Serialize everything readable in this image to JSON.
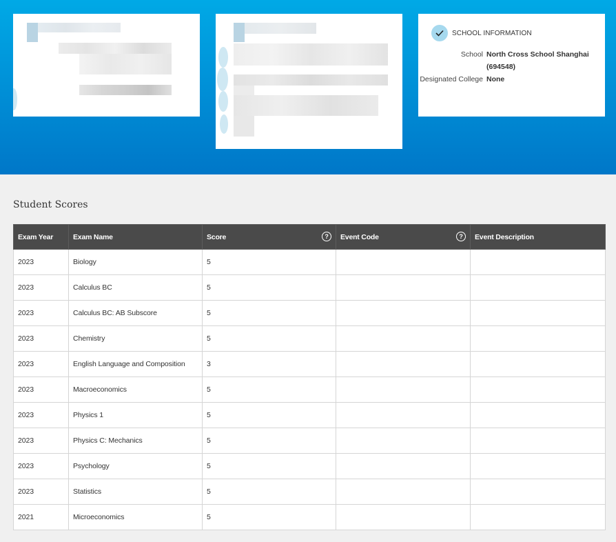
{
  "school_info": {
    "title": "SCHOOL INFORMATION",
    "school_label": "School",
    "school_value": "North Cross School Shanghai (694548)",
    "college_label": "Designated College",
    "college_value": "None",
    "icon": "check-icon"
  },
  "scores": {
    "section_title": "Student Scores",
    "columns": [
      "Exam Year",
      "Exam Name",
      "Score",
      "Event Code",
      "Event Description"
    ],
    "help_glyph": "?",
    "rows": [
      {
        "year": "2023",
        "exam": "Biology",
        "score": "5",
        "code": "",
        "desc": ""
      },
      {
        "year": "2023",
        "exam": "Calculus BC",
        "score": "5",
        "code": "",
        "desc": ""
      },
      {
        "year": "2023",
        "exam": "Calculus BC: AB Subscore",
        "score": "5",
        "code": "",
        "desc": ""
      },
      {
        "year": "2023",
        "exam": "Chemistry",
        "score": "5",
        "code": "",
        "desc": ""
      },
      {
        "year": "2023",
        "exam": "English Language and Composition",
        "score": "3",
        "code": "",
        "desc": ""
      },
      {
        "year": "2023",
        "exam": "Macroeconomics",
        "score": "5",
        "code": "",
        "desc": ""
      },
      {
        "year": "2023",
        "exam": "Physics 1",
        "score": "5",
        "code": "",
        "desc": ""
      },
      {
        "year": "2023",
        "exam": "Physics C: Mechanics",
        "score": "5",
        "code": "",
        "desc": ""
      },
      {
        "year": "2023",
        "exam": "Psychology",
        "score": "5",
        "code": "",
        "desc": ""
      },
      {
        "year": "2023",
        "exam": "Statistics",
        "score": "5",
        "code": "",
        "desc": ""
      },
      {
        "year": "2021",
        "exam": "Microeconomics",
        "score": "5",
        "code": "",
        "desc": ""
      }
    ]
  }
}
